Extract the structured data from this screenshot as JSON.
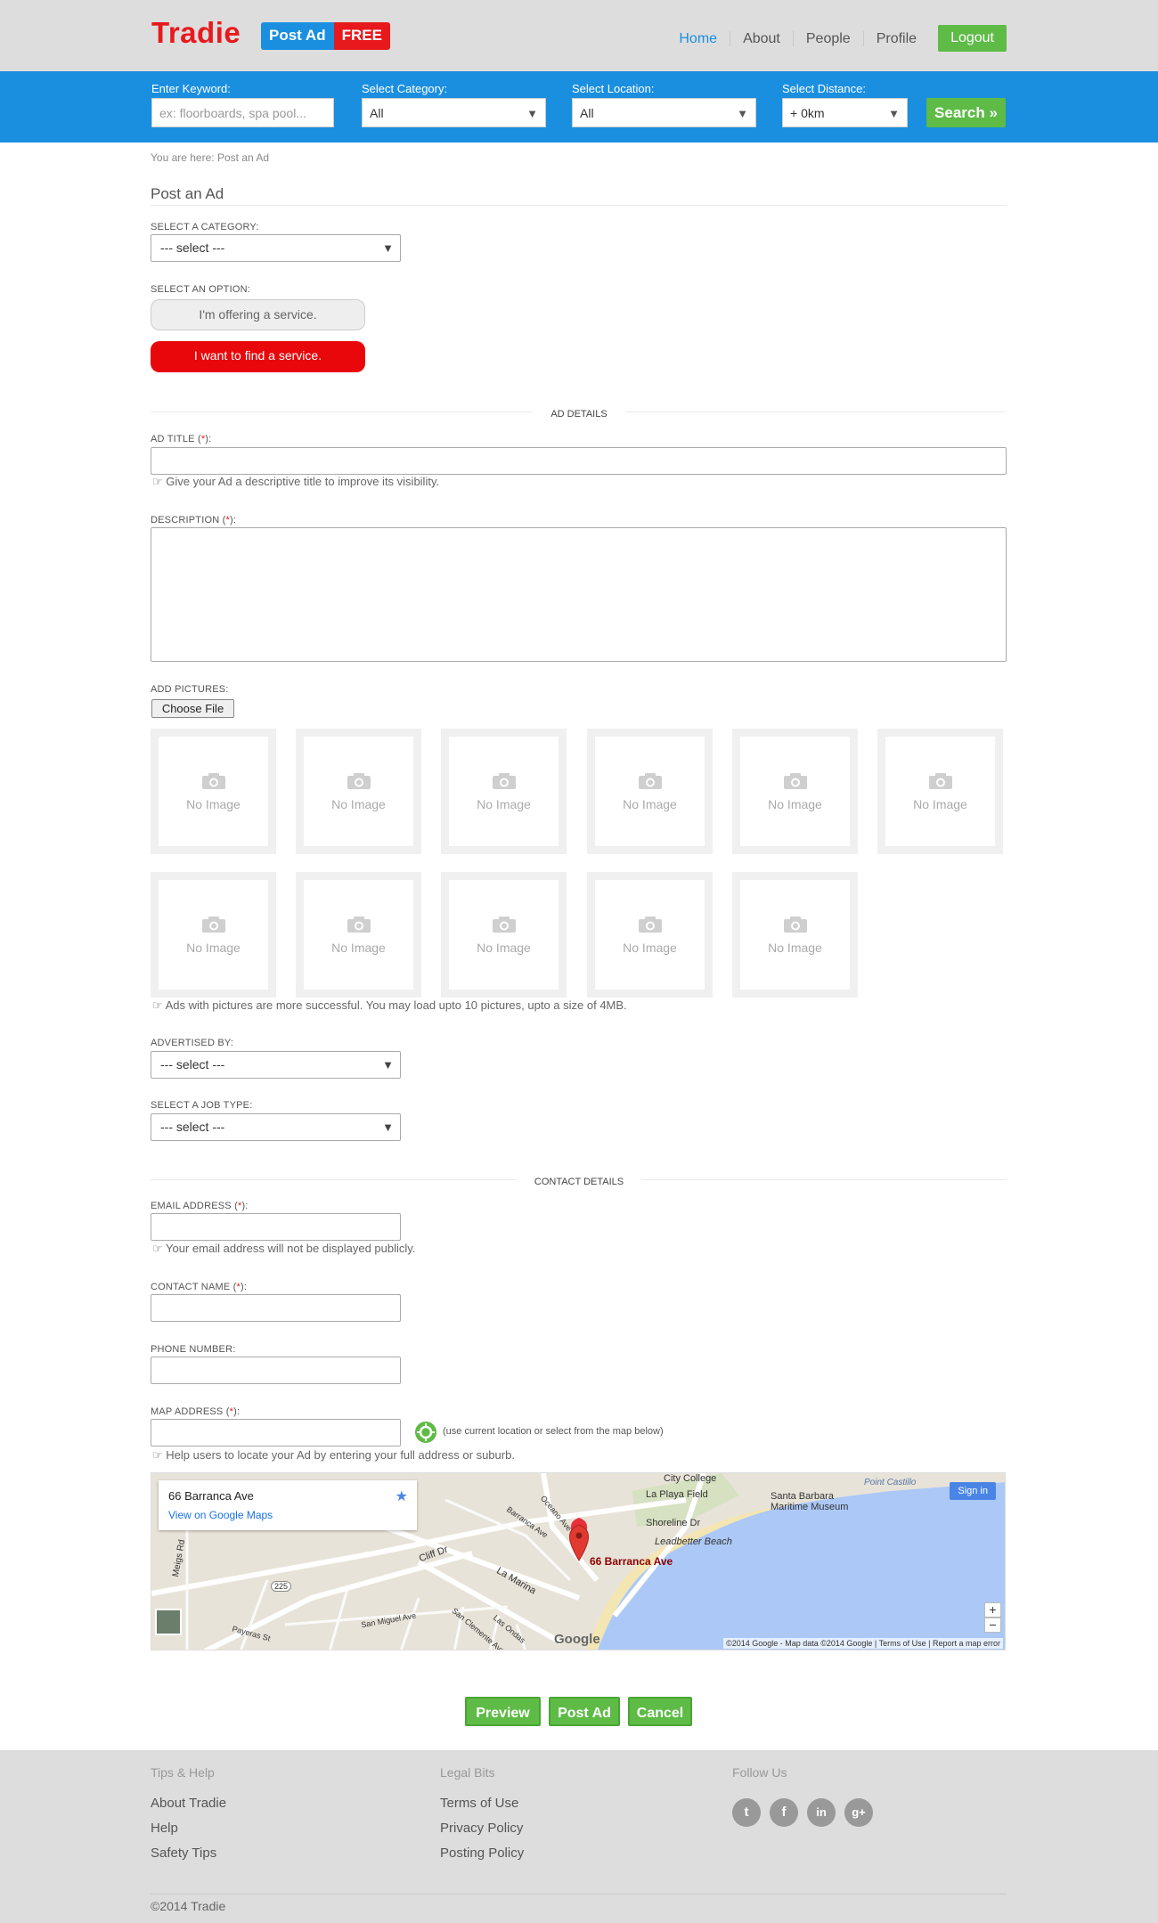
{
  "header": {
    "logo": "Tradie",
    "post_ad": "Post Ad",
    "free": "FREE",
    "nav": [
      "Home",
      "About",
      "People",
      "Profile"
    ],
    "logout": "Logout",
    "accent": "#1a8fe0",
    "brand": "#e8191c",
    "button_green": "#5dbb46"
  },
  "search": {
    "keyword_label": "Enter Keyword:",
    "keyword_placeholder": "ex: floorboards, spa pool...",
    "category_label": "Select Category:",
    "category_value": "All",
    "location_label": "Select Location:",
    "location_value": "All",
    "distance_label": "Select Distance:",
    "distance_value": "+ 0km",
    "search_button": "Search »"
  },
  "breadcrumb": "You are here:  Post an Ad",
  "page_title": "Post an Ad",
  "form": {
    "category_label": "SELECT A CATEGORY:",
    "category_value": "--- select ---",
    "option_label": "SELECT AN OPTION:",
    "option_offering": "I'm offering a service.",
    "option_find": "I want to find a service.",
    "ad_details": "AD DETAILS",
    "ad_title_label": "AD TITLE (",
    "ad_title_hint": "Give your Ad a descriptive title to improve its visibility.",
    "description_label": "DESCRIPTION (",
    "add_pictures_label": "ADD PICTURES:",
    "choose_file": "Choose File",
    "no_image": "No Image",
    "pictures_hint": "Ads with pictures are more successful. You may load upto 10 pictures, upto a size of 4MB.",
    "advertised_by_label": "ADVERTISED BY:",
    "advertised_by_value": "--- select ---",
    "job_type_label": "SELECT A JOB TYPE:",
    "job_type_value": "--- select ---",
    "contact_details": "CONTACT DETAILS",
    "email_label": "EMAIL ADDRESS (",
    "email_hint": "Your email address will not be displayed publicly.",
    "contact_name_label": "CONTACT NAME (",
    "phone_label": "PHONE NUMBER:",
    "map_address_label": "MAP ADDRESS (",
    "map_address_hint": "(use current location or select from the map below)",
    "map_help": "Help users to locate your Ad by entering your full address or suburb.",
    "req_star": "*",
    "req_close": "):"
  },
  "map": {
    "place": "66 Barranca Ave",
    "view_link": "View on Google Maps",
    "sign_in": "Sign in",
    "marker_label": "66 Barranca Ave",
    "footer": "©2014 Google - Map data ©2014 Google   |   Terms of Use   |   Report a map error",
    "labels": [
      "City College",
      "La Playa Field",
      "Shoreline Dr",
      "Santa Barbara Maritime Museum",
      "Point Castillo",
      "Leadbetter Beach",
      "Cliff Dr",
      "La Marina",
      "Barranca Ave",
      "Oceano Ave",
      "Meigs Rd",
      "Payeras St",
      "San Miguel Ave",
      "Las Ondas",
      "San Clemente Ave",
      "Google",
      "225"
    ]
  },
  "actions": {
    "preview": "Preview",
    "post_ad": "Post Ad",
    "cancel": "Cancel"
  },
  "footer": {
    "col1_title": "Tips & Help",
    "col1": [
      "About Tradie",
      "Help",
      "Safety Tips"
    ],
    "col2_title": "Legal Bits",
    "col2": [
      "Terms of Use",
      "Privacy Policy",
      "Posting Policy"
    ],
    "col3_title": "Follow Us",
    "social": [
      "twitter-icon",
      "facebook-icon",
      "linkedin-icon",
      "google-plus-icon"
    ],
    "copyright": "©2014 Tradie"
  }
}
